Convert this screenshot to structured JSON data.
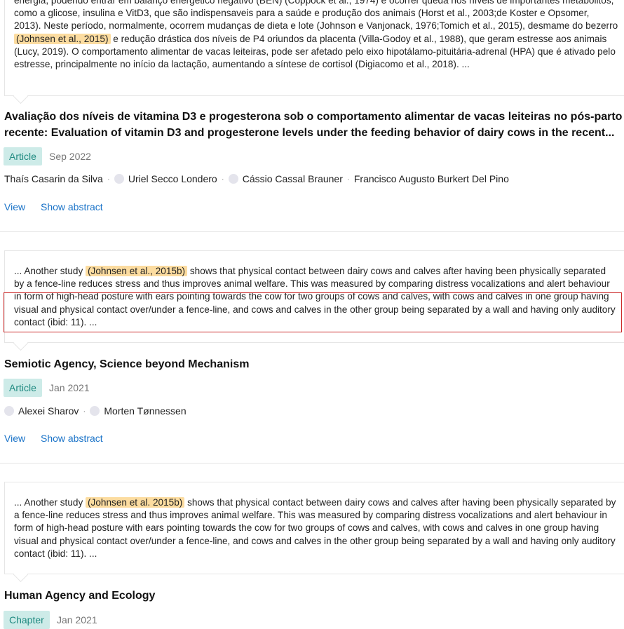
{
  "results": [
    {
      "quote": {
        "before": "energia, podendo entrar em balanço energético negativo (BEN) (Coppock et al., 1974) e ocorrer queda nos níveis de importantes metabolitos, como a glicose, insulina e VitD3, que são indispensaveis para a saúde e produção dos animais (Horst et al., 2003;de Koster e Opsomer, 2013). Neste período, normalmente, ocorrem mudanças de dieta e lote (Johnson e Vanjonack, 1976;Tomich et al., 2015), desmame do bezerro ",
        "highlight": "(Johnsen et al., 2015)",
        "after": " e redução drástica dos níveis de P4 oriundos da placenta (Villa-Godoy et al., 1988), que geram estresse aos animais (Lucy, 2019). O comportamento alimentar de vacas leiteiras, pode ser afetado pelo eixo hipotálamo-pituitária-adrenal (HPA) que é ativado pelo estresse, principalmente no início da lactação, aumentando a síntese de cortisol (Digiacomo et al., 2018). ..."
      },
      "title": "Avaliação dos níveis de vitamina D3 e progesterona sob o comportamento alimentar de vacas leiteiras no pós-parto recente: Evaluation of vitamin D3 and progesterone levels under the feeding behavior of dairy cows in the recent...",
      "type": "Article",
      "date": "Sep 2022",
      "authors": [
        "Thaís Casarin da Silva",
        "Uriel Secco Londero",
        "Cássio Cassal Brauner",
        "Francisco Augusto Burkert Del Pino"
      ],
      "view_label": "View",
      "abstract_label": "Show abstract"
    },
    {
      "quote": {
        "before": "... Another study ",
        "highlight": "(Johnsen et al., 2015b)",
        "after": " shows that physical contact between dairy cows and calves after having been physically separated by a fence-line reduces stress and thus improves animal welfare. This was measured by comparing distress vocalizations and alert behaviour in form of high-head posture with ears pointing towards the cow for two groups of cows and calves, with cows and calves in one group having visual and physical contact over/under a fence-line, and cows and calves in the other group being separated by a wall and having only auditory contact (ibid: 11). ..."
      },
      "title": "Semiotic Agency, Science beyond Mechanism",
      "type": "Article",
      "date": "Jan 2021",
      "authors": [
        "Alexei Sharov",
        "Morten Tønnessen"
      ],
      "view_label": "View",
      "abstract_label": "Show abstract"
    },
    {
      "quote": {
        "before": "... Another study ",
        "highlight": "(Johnsen et al. 2015b)",
        "after": " shows that physical contact between dairy cows and calves after having been physically separated by a fence-line reduces stress and thus improves animal welfare. This was measured by comparing distress vocalizations and alert behaviour in form of high-head posture with ears pointing towards the cow for two groups of cows and calves, with cows and calves in one group having visual and physical contact over/under a fence-line, and cows and calves in the other group being separated by a wall and having only auditory contact (ibid: 11). ..."
      },
      "title": "Human Agency and Ecology",
      "type": "Chapter",
      "date": "Jan 2021"
    }
  ]
}
